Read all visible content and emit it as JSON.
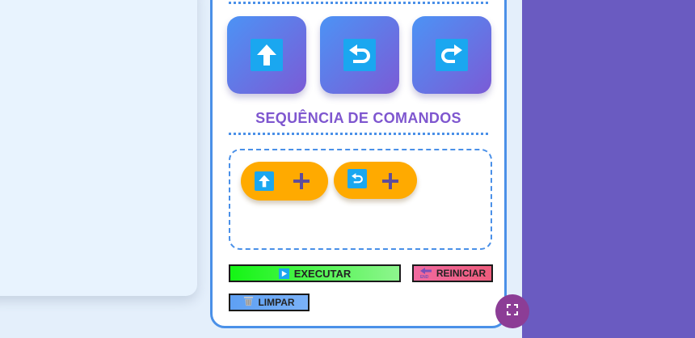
{
  "commands": [
    {
      "name": "forward",
      "icon": "arrow-up-icon"
    },
    {
      "name": "turn-left",
      "icon": "turn-left-icon"
    },
    {
      "name": "turn-right",
      "icon": "turn-right-icon"
    }
  ],
  "sequence": {
    "title": "SEQUÊNCIA DE COMANDOS",
    "items": [
      {
        "icon": "arrow-up-icon",
        "action": "plus-icon"
      },
      {
        "icon": "turn-left-icon",
        "action": "plus-icon"
      }
    ]
  },
  "controls": {
    "execute_label": "EXECUTAR",
    "reset_label": "REINICIAR",
    "reset_icon_text": "END",
    "clear_label": "LIMPAR"
  },
  "fullscreen": {
    "icon": "fullscreen-icon"
  },
  "colors": {
    "accent": "#4a90e8",
    "title": "#7e56cf",
    "chip": "#ffaa00",
    "execute": "#14f514",
    "reset": "#f06aa0",
    "clear": "#5ea0f4",
    "fullscreen": "#8c3d96",
    "background_right": "#6a5bc1"
  }
}
